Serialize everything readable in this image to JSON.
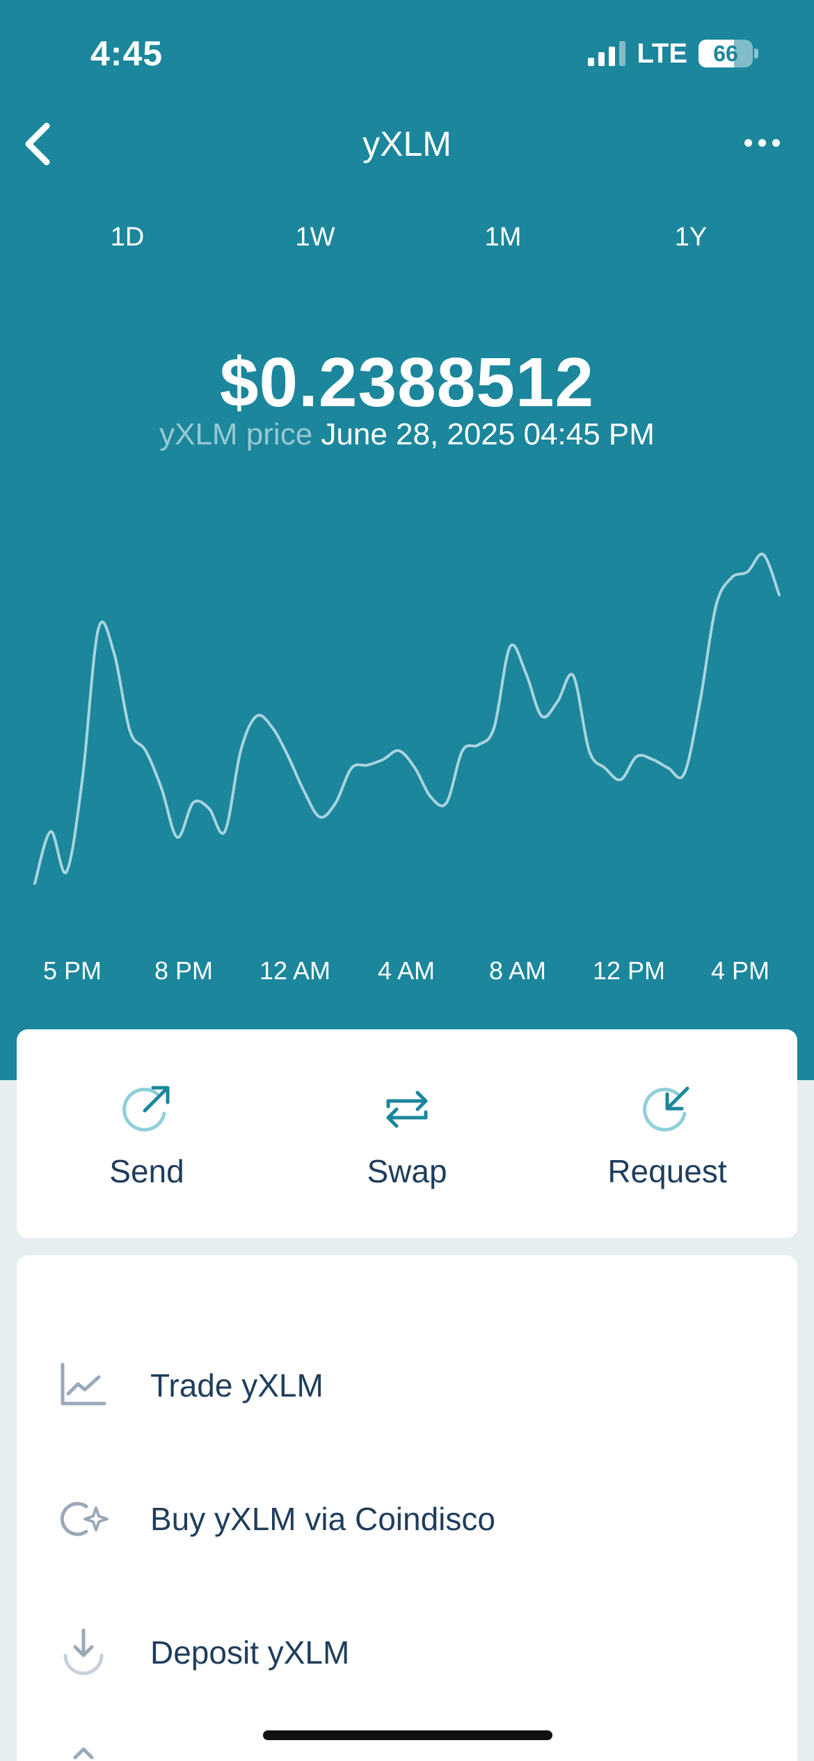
{
  "status_bar": {
    "time": "4:45",
    "network": "LTE",
    "battery": "66"
  },
  "nav": {
    "title": "yXLM"
  },
  "tabs": [
    {
      "label": "1D",
      "active": true
    },
    {
      "label": "1W",
      "active": false
    },
    {
      "label": "1M",
      "active": false
    },
    {
      "label": "1Y",
      "active": false
    }
  ],
  "price": {
    "value": "$0.2388512",
    "label": "yXLM price",
    "datetime": "June 28, 2025 04:45 PM"
  },
  "chart_data": {
    "type": "line",
    "x_ticks": [
      "5 PM",
      "8 PM",
      "12 AM",
      "4 AM",
      "8 AM",
      "12 PM",
      "4 PM"
    ],
    "series": [
      {
        "values": [
          0.2272,
          0.229,
          0.2276,
          0.2308,
          0.236,
          0.2352,
          0.2325,
          0.2318,
          0.2305,
          0.2288,
          0.23,
          0.2298,
          0.229,
          0.2318,
          0.233,
          0.2326,
          0.2316,
          0.2304,
          0.2295,
          0.23,
          0.2312,
          0.2313,
          0.2315,
          0.2318,
          0.2312,
          0.2302,
          0.23,
          0.2318,
          0.232,
          0.2326,
          0.2354,
          0.2345,
          0.233,
          0.2335,
          0.2344,
          0.2318,
          0.2312,
          0.2308,
          0.2316,
          0.2315,
          0.2312,
          0.231,
          0.2335,
          0.2368,
          0.2378,
          0.238,
          0.2386,
          0.2372
        ],
        "color": "#a9d4df"
      }
    ],
    "ylim": [
      0.226,
      0.2395
    ]
  },
  "actions": [
    {
      "label": "Send",
      "icon": "send-icon"
    },
    {
      "label": "Swap",
      "icon": "swap-icon"
    },
    {
      "label": "Request",
      "icon": "request-icon"
    }
  ],
  "menu": [
    {
      "label": "Trade yXLM",
      "icon": "trade-chart-icon"
    },
    {
      "label": "Buy yXLM via Coindisco",
      "icon": "buy-sparkle-icon"
    },
    {
      "label": "Deposit yXLM",
      "icon": "deposit-icon"
    }
  ],
  "colors": {
    "background": "#1b869c",
    "tab_indicator": "#2cc36a",
    "chart_line": "#a9d4df",
    "text_dark": "#1f3d5c",
    "icon_muted": "#9aa8b8"
  }
}
